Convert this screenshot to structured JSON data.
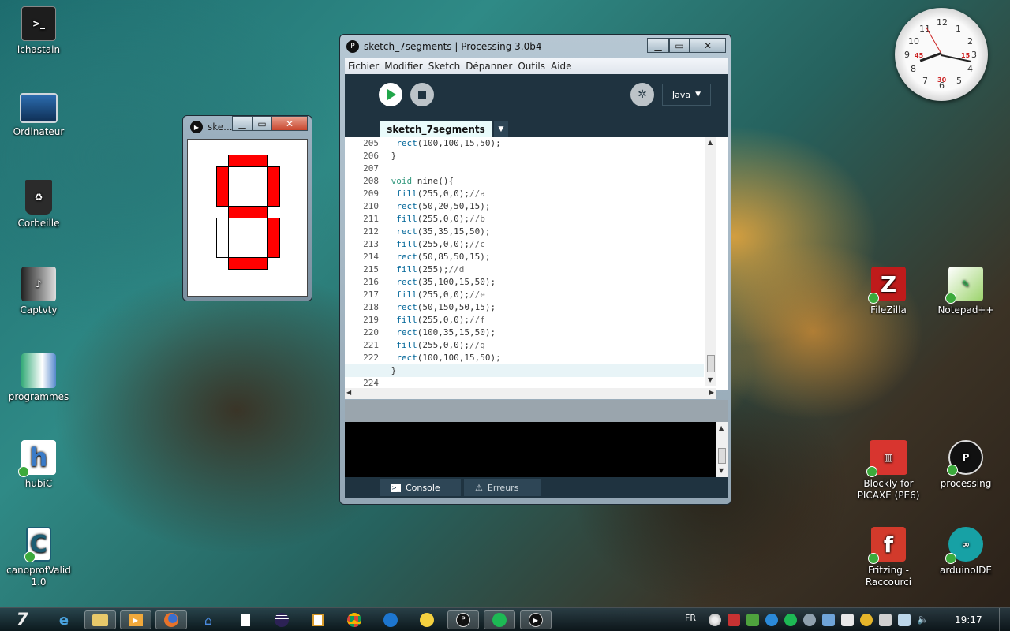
{
  "desktop": {
    "left_icons": [
      {
        "label": "lchastain"
      },
      {
        "label": "Ordinateur"
      },
      {
        "label": "Corbeille"
      },
      {
        "label": "Captvty"
      },
      {
        "label": "programmes"
      },
      {
        "label": "hubiC"
      },
      {
        "label": "canoprofValid 1.0"
      }
    ],
    "right_icons": [
      {
        "label": "FileZilla"
      },
      {
        "label": "Notepad++"
      },
      {
        "label": "Blockly for PICAXE (PE6)"
      },
      {
        "label": "processing"
      },
      {
        "label": "Fritzing - Raccourci"
      },
      {
        "label": "arduinoIDE"
      }
    ]
  },
  "clock": {
    "numbers": [
      "12",
      "1",
      "2",
      "3",
      "4",
      "5",
      "6",
      "7",
      "8",
      "9",
      "10",
      "11"
    ],
    "red_labels": [
      "45",
      "15",
      "30"
    ]
  },
  "sketch_window": {
    "title": "ske...",
    "segments": {
      "a": "red",
      "b": "red",
      "c": "red",
      "d": "white",
      "e": "red",
      "f": "red",
      "g": "red"
    }
  },
  "processing_window": {
    "title": "sketch_7segments | Processing 3.0b4",
    "menu": [
      "Fichier",
      "Modifier",
      "Sketch",
      "Dépanner",
      "Outils",
      "Aide"
    ],
    "mode": "Java",
    "tab": "sketch_7segments",
    "line_numbers": [
      "205",
      "206",
      "207",
      "208",
      "209",
      "210",
      "211",
      "212",
      "213",
      "214",
      "215",
      "216",
      "217",
      "218",
      "219",
      "220",
      "221",
      "222",
      "223",
      "224"
    ],
    "code": [
      [
        {
          "t": "  "
        },
        {
          "t": "rect",
          "c": "fn"
        },
        {
          "t": "(100,100,15,50);"
        }
      ],
      [
        {
          "t": " }"
        }
      ],
      [
        {
          "t": ""
        }
      ],
      [
        {
          "t": " "
        },
        {
          "t": "void",
          "c": "kw"
        },
        {
          "t": " nine(){"
        }
      ],
      [
        {
          "t": "  "
        },
        {
          "t": "fill",
          "c": "fn"
        },
        {
          "t": "(255,0,0);"
        },
        {
          "t": "//a",
          "c": "cm"
        }
      ],
      [
        {
          "t": "  "
        },
        {
          "t": "rect",
          "c": "fn"
        },
        {
          "t": "(50,20,50,15);"
        }
      ],
      [
        {
          "t": "  "
        },
        {
          "t": "fill",
          "c": "fn"
        },
        {
          "t": "(255,0,0);"
        },
        {
          "t": "//b",
          "c": "cm"
        }
      ],
      [
        {
          "t": "  "
        },
        {
          "t": "rect",
          "c": "fn"
        },
        {
          "t": "(35,35,15,50);"
        }
      ],
      [
        {
          "t": "  "
        },
        {
          "t": "fill",
          "c": "fn"
        },
        {
          "t": "(255,0,0);"
        },
        {
          "t": "//c",
          "c": "cm"
        }
      ],
      [
        {
          "t": "  "
        },
        {
          "t": "rect",
          "c": "fn"
        },
        {
          "t": "(50,85,50,15);"
        }
      ],
      [
        {
          "t": "  "
        },
        {
          "t": "fill",
          "c": "fn"
        },
        {
          "t": "(255);"
        },
        {
          "t": "//d",
          "c": "cm"
        }
      ],
      [
        {
          "t": "  "
        },
        {
          "t": "rect",
          "c": "fn"
        },
        {
          "t": "(35,100,15,50);"
        }
      ],
      [
        {
          "t": "  "
        },
        {
          "t": "fill",
          "c": "fn"
        },
        {
          "t": "(255,0,0);"
        },
        {
          "t": "//e",
          "c": "cm"
        }
      ],
      [
        {
          "t": "  "
        },
        {
          "t": "rect",
          "c": "fn"
        },
        {
          "t": "(50,150,50,15);"
        }
      ],
      [
        {
          "t": "  "
        },
        {
          "t": "fill",
          "c": "fn"
        },
        {
          "t": "(255,0,0);"
        },
        {
          "t": "//f",
          "c": "cm"
        }
      ],
      [
        {
          "t": "  "
        },
        {
          "t": "rect",
          "c": "fn"
        },
        {
          "t": "(100,35,15,50);"
        }
      ],
      [
        {
          "t": "  "
        },
        {
          "t": "fill",
          "c": "fn"
        },
        {
          "t": "(255,0,0);"
        },
        {
          "t": "//g",
          "c": "cm"
        }
      ],
      [
        {
          "t": "  "
        },
        {
          "t": "rect",
          "c": "fn"
        },
        {
          "t": "(100,100,15,50);"
        }
      ],
      [
        {
          "t": " }"
        }
      ],
      [
        {
          "t": ""
        }
      ]
    ],
    "console_tab": "Console",
    "errors_tab": "Erreurs"
  },
  "taskbar": {
    "language": "FR",
    "time": "19:17",
    "items": [
      "start-orb",
      "ie",
      "explorer",
      "media-player",
      "firefox",
      "hubic",
      "file",
      "eclipse",
      "calculator",
      "chrome",
      "teamviewer",
      "captvty",
      "processing",
      "spotify",
      "processing-sketch"
    ]
  },
  "colors": {
    "segment_on": "#ff0000",
    "segment_off": "#ffffff",
    "editor_dark": "#1f3340",
    "run_green": "#21a64a"
  }
}
